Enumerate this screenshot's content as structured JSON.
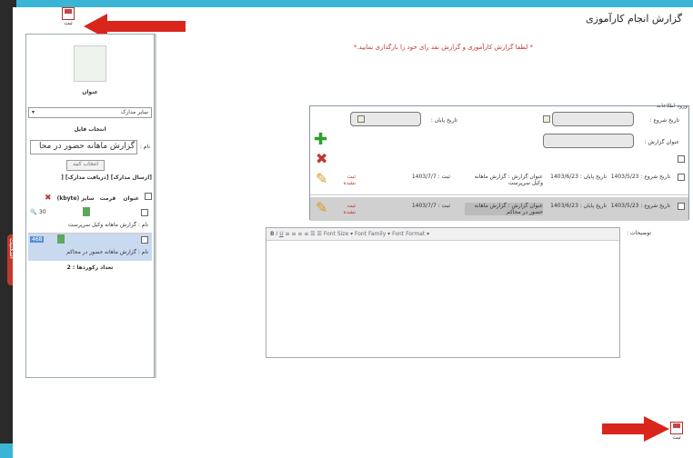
{
  "page_title": "گزارش انجام کارآموزی",
  "instruction": "* لطفا گزارش کارآموزی و گزارش نقد رای خود را بارگذاری نمایید.*",
  "left_tab_label": "اسکنیت",
  "top_save": {
    "label": "ثبت"
  },
  "bottom_save": {
    "label": "ثبت"
  },
  "panel": {
    "title_label": "عنوان",
    "select_value": "سایر مدارک",
    "file_select_header": "انتخاب فایل",
    "name_prefix": "نام :",
    "name_value": "گزارش ماهانه حضور در محا",
    "choose_button": "انتخاب کنید",
    "send_docs_label": "[ارسال مدارک] [دریافت مدارک] [",
    "table_headers": [
      "عنوان",
      "قرمت",
      "سایز (kbyte)"
    ],
    "files": [
      {
        "size": "30",
        "name": "نام : گزارش ماهانه وکیل سرپرست"
      },
      {
        "size": "468",
        "name": "نام : گزارش ماهانه حضور در محاکم"
      }
    ],
    "records_count": "تعداد رکوردها : 2"
  },
  "info_section": {
    "legend": "ورود اطلاعات",
    "start_date_label": "تاریخ شروع :",
    "end_date_label": "تاریخ پایان :",
    "report_title_label": "عنوان گزارش :",
    "rows": [
      {
        "start": "تاریخ شروع : 1403/5/23",
        "end": "تاریخ پایان : 1403/6/23",
        "title": "عنوان گزارش :  گزارش ماهانه وکیل سرپرست",
        "submit": "ثبت : 1403/7/7",
        "status": "ثبت نشده"
      },
      {
        "start": "تاریخ شروع : 1403/5/23",
        "end": "تاریخ پایان : 1403/6/23",
        "title": "عنوان گزارش :  گزارش ماهانه حضور در محاکم",
        "submit": "ثبت : 1403/7/7",
        "status": "ثبت نشده"
      }
    ]
  },
  "editor": {
    "label": "توضیحات :",
    "font_size": "Font Size",
    "font_family": "Font Family",
    "font_format": "Font Format"
  },
  "colors": {
    "accent_red": "#d9261c",
    "frame_bg": "#3ab5d6"
  }
}
